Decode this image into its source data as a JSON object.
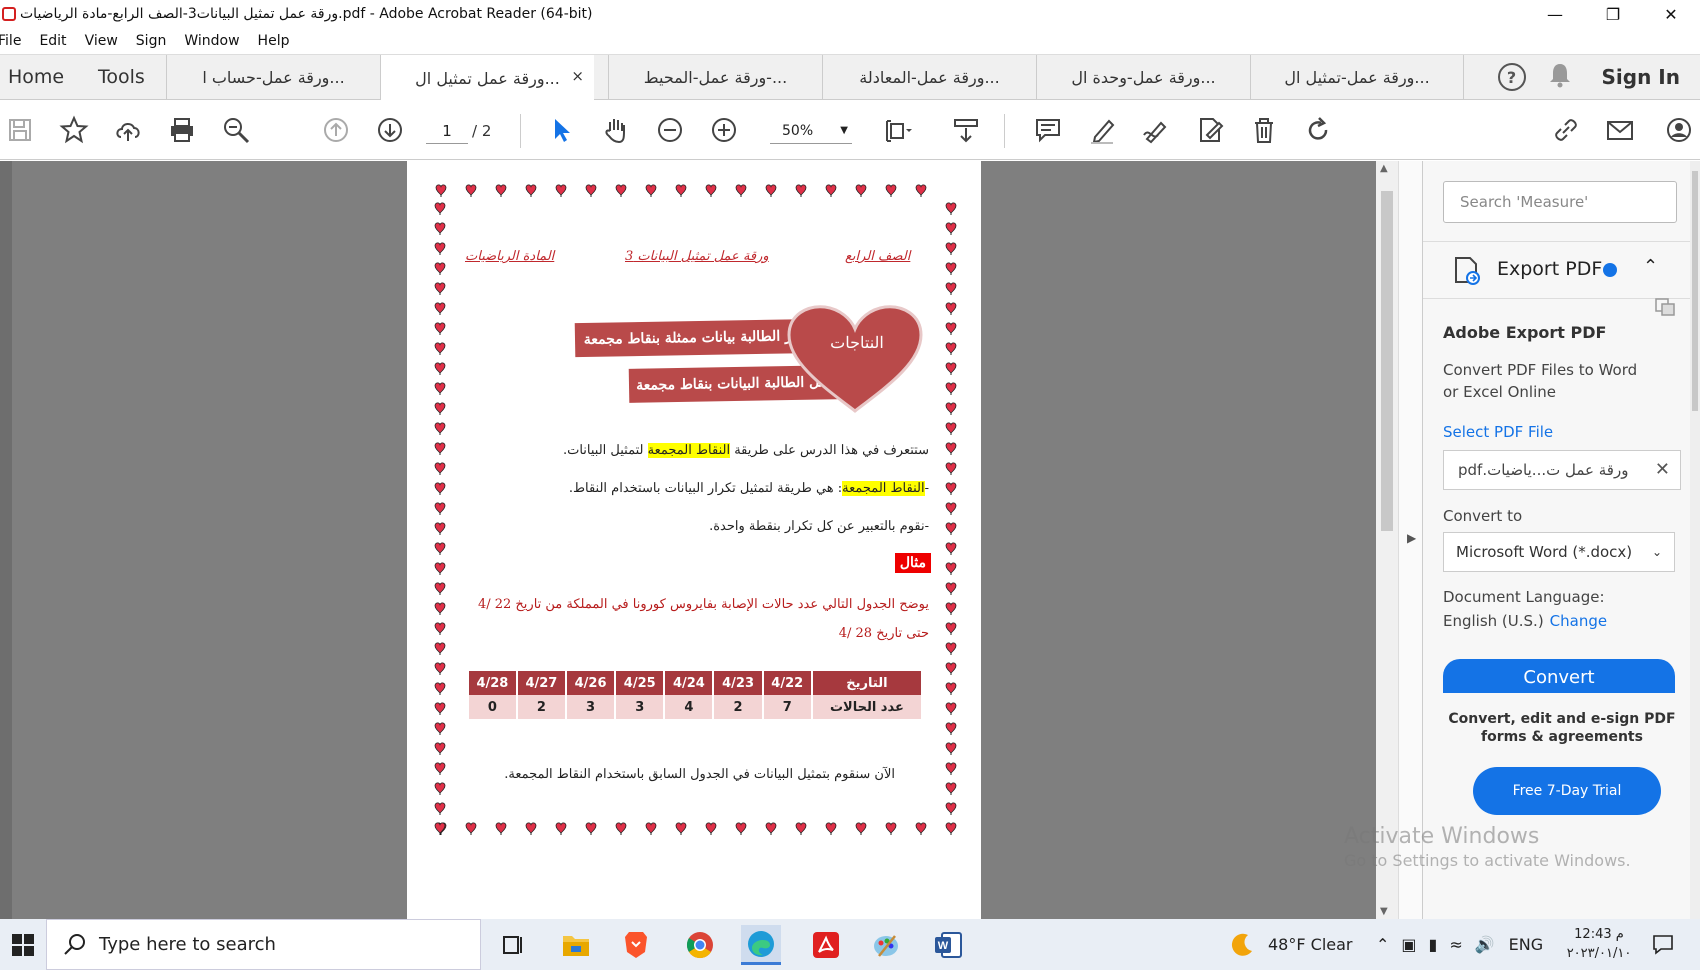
{
  "window": {
    "title": "ورقة عمل تمثيل البيانات3-الصف الرابع-مادة الرياضيات.pdf - Adobe Acrobat Reader (64-bit)"
  },
  "menu": [
    "File",
    "Edit",
    "View",
    "Sign",
    "Window",
    "Help"
  ],
  "nav": {
    "home": "Home",
    "tools": "Tools",
    "sign_in": "Sign In"
  },
  "tabs": [
    {
      "label": "ورقة عمل-حساب ا...",
      "active": false
    },
    {
      "label": "ورقة عمل تمثيل ال...",
      "active": true,
      "close": "×"
    },
    {
      "label": "ورقة عمل-المحيط-...",
      "active": false
    },
    {
      "label": "ورقة عمل-المعادلة...",
      "active": false
    },
    {
      "label": "ورقة عمل-وحدة ال...",
      "active": false
    },
    {
      "label": "ورقة عمل-تمثيل ال...",
      "active": false
    }
  ],
  "toolbar": {
    "page_current": "1",
    "page_total": "/ 2",
    "zoom": "50%"
  },
  "worksheet": {
    "header_grade": "الصف الرابع",
    "header_title": "ورقة عمل تمثيل البيانات 3",
    "header_subject": "المادة الرياضيات",
    "outcomes_label": "النتاجات",
    "outcome_1": "تفسر الطالبة بيانات ممثلة بنقاط مجمعة",
    "outcome_2": "تمثل الطالبة البيانات بنقاط مجمعة",
    "line1_a": "ستتعرف في هذا الدرس على طريقة ",
    "line1_hl": "النقاط المجمعة",
    "line1_b": " لتمثيل البيانات.",
    "line2_a": "-",
    "line2_hl": "النقاط المجمعة",
    "line2_b": ": هي طريقة لتمثيل تكرار البيانات باستخدام النقاط.",
    "line3": "-نقوم بالتعبير عن كل تكرار بنقطة واحدة.",
    "example_badge": "مثال",
    "example_line1": "يوضح الجدول التالي عدد حالات الإصابة بفايروس كورونا في المملكة من تاريخ 22 /4",
    "example_line2": "حتى تاريخ 28 /4",
    "table_header_label": "التاريخ",
    "table_row_label": "عدد الحالات",
    "table_dates": [
      "4/22",
      "4/23",
      "4/24",
      "4/25",
      "4/26",
      "4/27",
      "4/28"
    ],
    "table_counts": [
      "7",
      "2",
      "4",
      "3",
      "3",
      "2",
      "0"
    ],
    "closing_line": "الآن سنقوم بتمثيل البيانات في الجدول السابق باستخدام النقاط المجمعة."
  },
  "right_panel": {
    "search_placeholder": "Search 'Measure'",
    "export_label": "Export PDF",
    "title": "Adobe Export PDF",
    "description": "Convert PDF Files to Word or Excel Online",
    "select_file": "Select PDF File",
    "file_name": "ورقة عمل ت...ياضيات.pdf",
    "convert_to_label": "Convert to",
    "format": "Microsoft Word (*.docx)",
    "doc_lang_label": "Document Language:",
    "doc_lang_value": "English (U.S.)",
    "doc_lang_change": "Change",
    "convert_button": "Convert",
    "promo": "Convert, edit and e-sign PDF forms & agreements",
    "trial_button": "Free 7-Day Trial"
  },
  "watermark": {
    "line1": "Activate Windows",
    "line2": "Go to Settings to activate Windows."
  },
  "taskbar": {
    "search_placeholder": "Type here to search",
    "weather": "48°F  Clear",
    "lang": "ENG",
    "time": "12:43 م",
    "date": "٢٠٢٣/٠١/١٠"
  },
  "colors": {
    "accent": "#1473e6",
    "worksheet_red": "#c0282d",
    "highlight": "#ffff00"
  }
}
